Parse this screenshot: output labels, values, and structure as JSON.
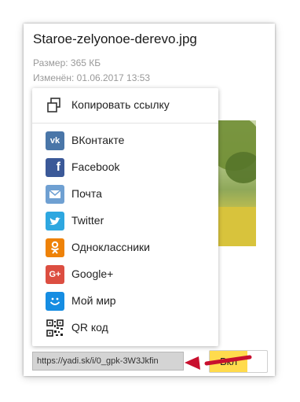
{
  "file": {
    "name": "Staroe-zelyonoe-derevo.jpg",
    "size_line": "Размер: 365 КБ",
    "date_line": "Изменён: 01.06.2017 13:53"
  },
  "share_menu": {
    "copy_link": {
      "label": "Копировать ссылку",
      "icon": "copy-link-icon"
    },
    "items": [
      {
        "label": "ВКонтакте",
        "icon": "vk-icon",
        "color": "#4a76a8",
        "glyph": "vk"
      },
      {
        "label": "Facebook",
        "icon": "facebook-icon",
        "color": "#3b5998",
        "glyph": "f"
      },
      {
        "label": "Почта",
        "icon": "mail-icon",
        "color": "#6fa0d2",
        "glyph": "✉"
      },
      {
        "label": "Twitter",
        "icon": "twitter-icon",
        "color": "#2ea7e0",
        "glyph": "t"
      },
      {
        "label": "Одноклассники",
        "icon": "odnoklassniki-icon",
        "color": "#ee8208",
        "glyph": "ok"
      },
      {
        "label": "Google+",
        "icon": "google-plus-icon",
        "color": "#dc4e41",
        "glyph": "G+"
      },
      {
        "label": "Мой мир",
        "icon": "moy-mir-icon",
        "color": "#168de2",
        "glyph": "☺"
      },
      {
        "label": "QR код",
        "icon": "qr-code-icon",
        "color": "#ffffff",
        "glyph": "qr"
      }
    ]
  },
  "public_link": {
    "value": "https://yadi.sk/i/0_gpk-3W3Jkfin",
    "toggle_label": "Вкл",
    "toggle_color": "#ffdb4d"
  },
  "annotation": {
    "arrow_color": "#c8102e"
  }
}
